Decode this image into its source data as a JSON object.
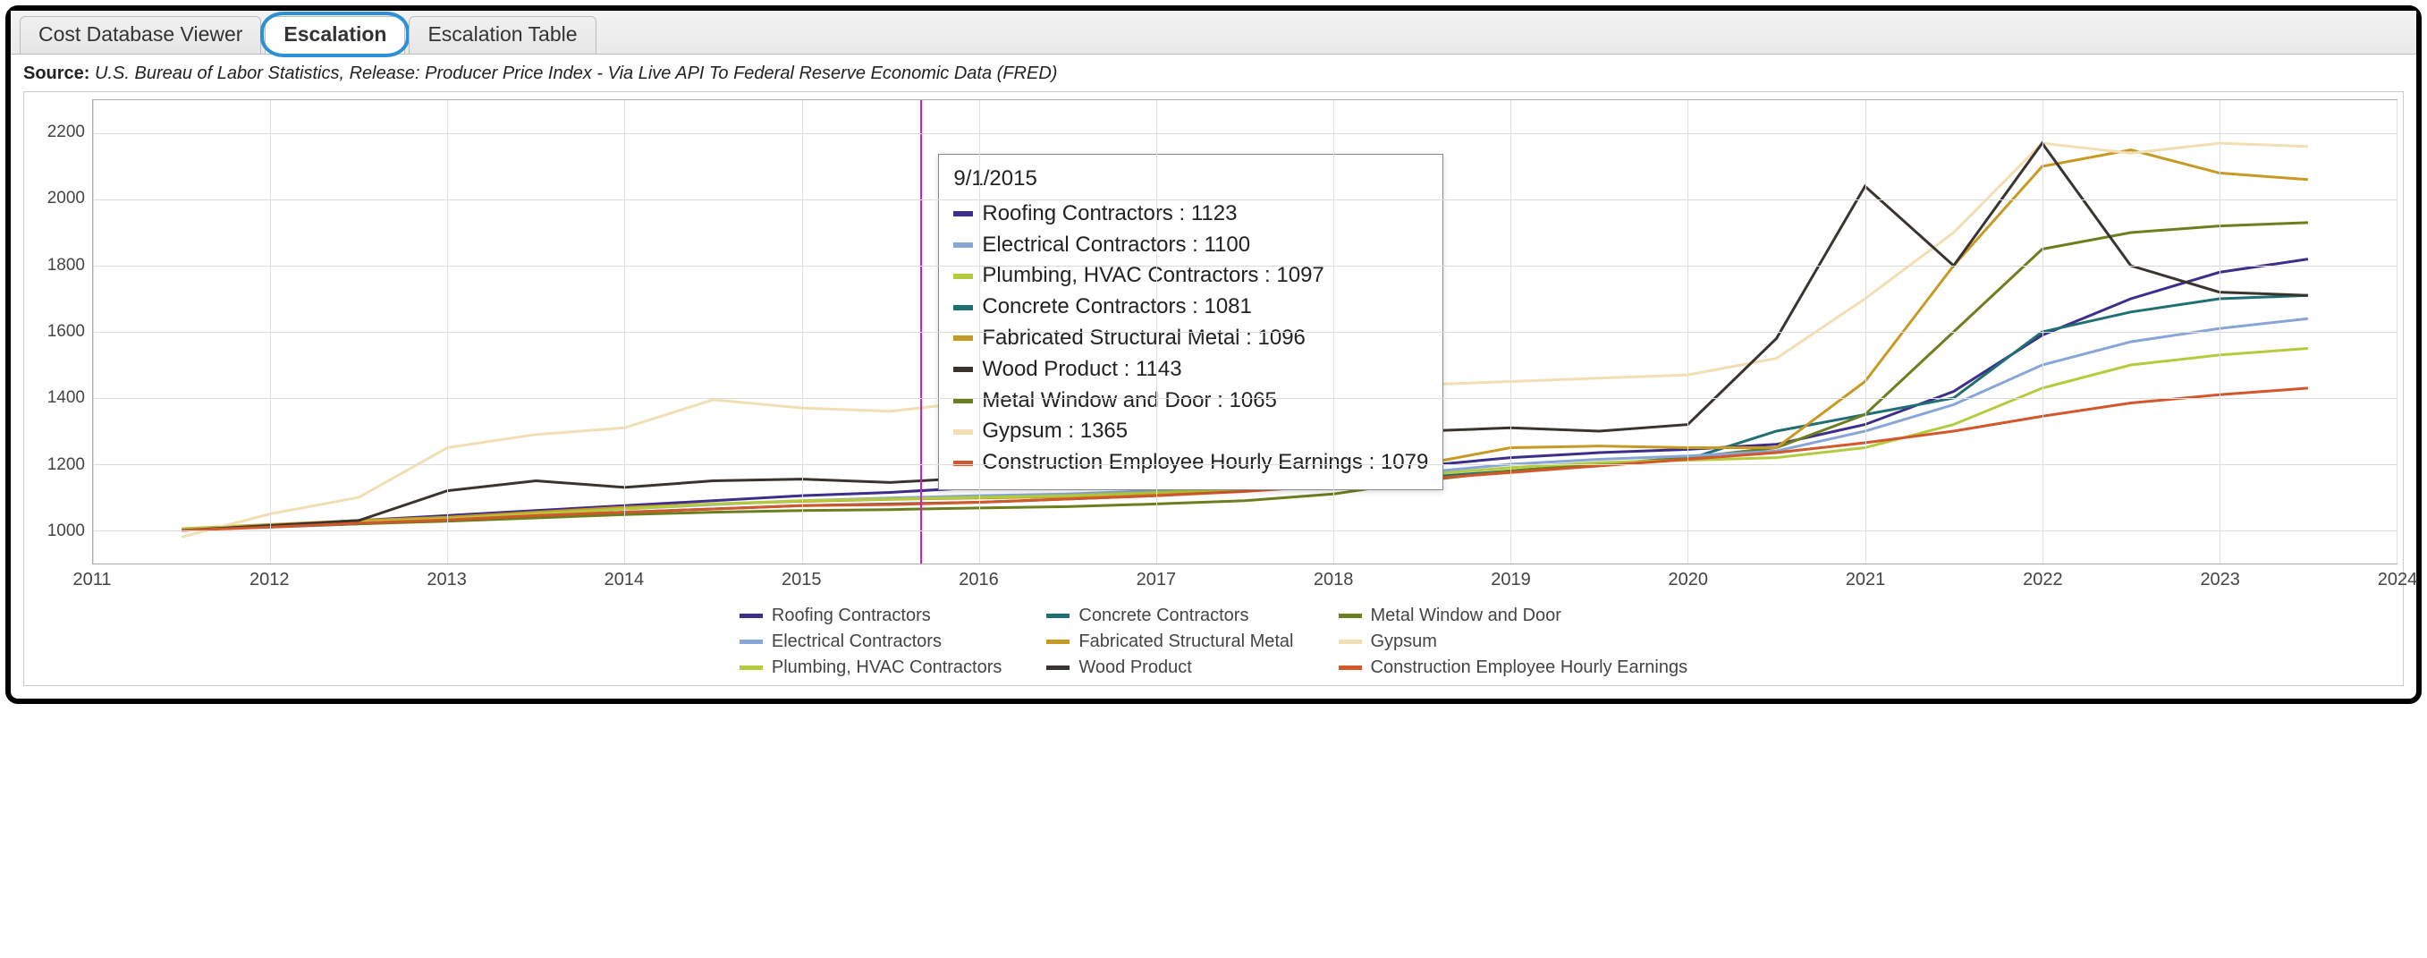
{
  "tabs": [
    {
      "id": "cost-db",
      "label": "Cost Database Viewer",
      "active": false
    },
    {
      "id": "escalation",
      "label": "Escalation",
      "active": true,
      "highlighted": true
    },
    {
      "id": "escalation-table",
      "label": "Escalation Table",
      "active": false
    }
  ],
  "source": {
    "label": "Source:",
    "text": "U.S. Bureau of Labor Statistics, Release: Producer Price Index  - Via Live API To Federal Reserve Economic Data (FRED)"
  },
  "chart_data": {
    "type": "line",
    "xlabel": "",
    "ylabel": "",
    "x_domain": [
      2011,
      2024
    ],
    "ylim": [
      900,
      2300
    ],
    "x_ticks": [
      2011,
      2012,
      2013,
      2014,
      2015,
      2016,
      2017,
      2018,
      2019,
      2020,
      2021,
      2022,
      2023,
      2024
    ],
    "y_ticks": [
      1000,
      1200,
      1400,
      1600,
      1800,
      2000,
      2200
    ],
    "years": [
      2011.5,
      2012,
      2012.5,
      2013,
      2013.5,
      2014,
      2014.5,
      2015,
      2015.5,
      2016,
      2016.5,
      2017,
      2017.5,
      2018,
      2018.5,
      2019,
      2019.5,
      2020,
      2020.5,
      2021,
      2021.5,
      2022,
      2022.5,
      2023,
      2023.5
    ],
    "series": [
      {
        "name": "Roofing Contractors",
        "color": "#3c2e8a",
        "values": [
          1005,
          1015,
          1030,
          1045,
          1060,
          1075,
          1090,
          1105,
          1115,
          1130,
          1130,
          1145,
          1155,
          1175,
          1195,
          1220,
          1235,
          1245,
          1260,
          1320,
          1420,
          1590,
          1700,
          1780,
          1820
        ]
      },
      {
        "name": "Concrete Contractors",
        "color": "#1f6f73",
        "values": [
          1005,
          1010,
          1020,
          1030,
          1045,
          1055,
          1065,
          1075,
          1080,
          1085,
          1095,
          1105,
          1120,
          1140,
          1160,
          1180,
          1200,
          1215,
          1300,
          1350,
          1400,
          1600,
          1660,
          1700,
          1710
        ]
      },
      {
        "name": "Metal Window and Door",
        "color": "#6b7f1e",
        "values": [
          1005,
          1012,
          1020,
          1028,
          1038,
          1048,
          1055,
          1060,
          1063,
          1068,
          1072,
          1080,
          1090,
          1110,
          1150,
          1180,
          1200,
          1220,
          1250,
          1350,
          1600,
          1850,
          1900,
          1920,
          1930
        ]
      },
      {
        "name": "Electrical Contractors",
        "color": "#88a5d8",
        "values": [
          1005,
          1015,
          1025,
          1035,
          1050,
          1065,
          1078,
          1090,
          1098,
          1105,
          1110,
          1120,
          1130,
          1150,
          1175,
          1200,
          1215,
          1225,
          1240,
          1300,
          1380,
          1500,
          1570,
          1610,
          1640
        ]
      },
      {
        "name": "Fabricated Structural Metal",
        "color": "#c79a25",
        "values": [
          1005,
          1018,
          1030,
          1040,
          1055,
          1070,
          1080,
          1088,
          1094,
          1098,
          1102,
          1110,
          1122,
          1150,
          1200,
          1250,
          1255,
          1250,
          1250,
          1450,
          1800,
          2100,
          2150,
          2080,
          2060
        ]
      },
      {
        "name": "Gypsum",
        "color": "#f2deb3",
        "values": [
          980,
          1050,
          1100,
          1250,
          1290,
          1310,
          1395,
          1370,
          1360,
          1390,
          1400,
          1410,
          1420,
          1430,
          1440,
          1450,
          1460,
          1470,
          1520,
          1700,
          1900,
          2170,
          2140,
          2170,
          2160
        ]
      },
      {
        "name": "Plumbing, HVAC Contractors",
        "color": "#b3cc3e",
        "values": [
          1005,
          1015,
          1025,
          1035,
          1050,
          1065,
          1080,
          1090,
          1095,
          1100,
          1105,
          1115,
          1125,
          1145,
          1168,
          1190,
          1205,
          1212,
          1220,
          1250,
          1320,
          1430,
          1500,
          1530,
          1550
        ]
      },
      {
        "name": "Wood Product",
        "color": "#3a342f",
        "values": [
          1000,
          1015,
          1030,
          1120,
          1150,
          1130,
          1150,
          1155,
          1145,
          1160,
          1180,
          1200,
          1260,
          1280,
          1300,
          1310,
          1300,
          1320,
          1580,
          2040,
          1800,
          2170,
          1800,
          1720,
          1710
        ]
      },
      {
        "name": "Construction Employee Hourly Earnings",
        "color": "#d4572b",
        "values": [
          1000,
          1010,
          1022,
          1032,
          1045,
          1055,
          1065,
          1075,
          1078,
          1085,
          1095,
          1105,
          1118,
          1135,
          1155,
          1175,
          1195,
          1215,
          1235,
          1265,
          1300,
          1345,
          1385,
          1410,
          1430
        ]
      }
    ],
    "tooltip": {
      "date": "9/1/2015",
      "x_year": 2015.67,
      "rows": [
        {
          "name": "Roofing Contractors",
          "value": 1123,
          "color": "#3c2e8a"
        },
        {
          "name": "Electrical Contractors",
          "value": 1100,
          "color": "#88a5d8"
        },
        {
          "name": "Plumbing, HVAC Contractors",
          "value": 1097,
          "color": "#b3cc3e"
        },
        {
          "name": "Concrete Contractors",
          "value": 1081,
          "color": "#1f6f73"
        },
        {
          "name": "Fabricated Structural Metal",
          "value": 1096,
          "color": "#c79a25"
        },
        {
          "name": "Wood Product",
          "value": 1143,
          "color": "#3a342f"
        },
        {
          "name": "Metal Window and Door",
          "value": 1065,
          "color": "#6b7f1e"
        },
        {
          "name": "Gypsum",
          "value": 1365,
          "color": "#f2deb3"
        },
        {
          "name": "Construction Employee Hourly Earnings",
          "value": 1079,
          "color": "#d4572b"
        }
      ]
    },
    "legend_order": [
      [
        "Roofing Contractors",
        "Concrete Contractors",
        "Metal Window and Door"
      ],
      [
        "Electrical Contractors",
        "Fabricated Structural Metal",
        "Gypsum"
      ],
      [
        "Plumbing, HVAC Contractors",
        "Wood Product",
        "Construction Employee Hourly Earnings"
      ]
    ]
  }
}
